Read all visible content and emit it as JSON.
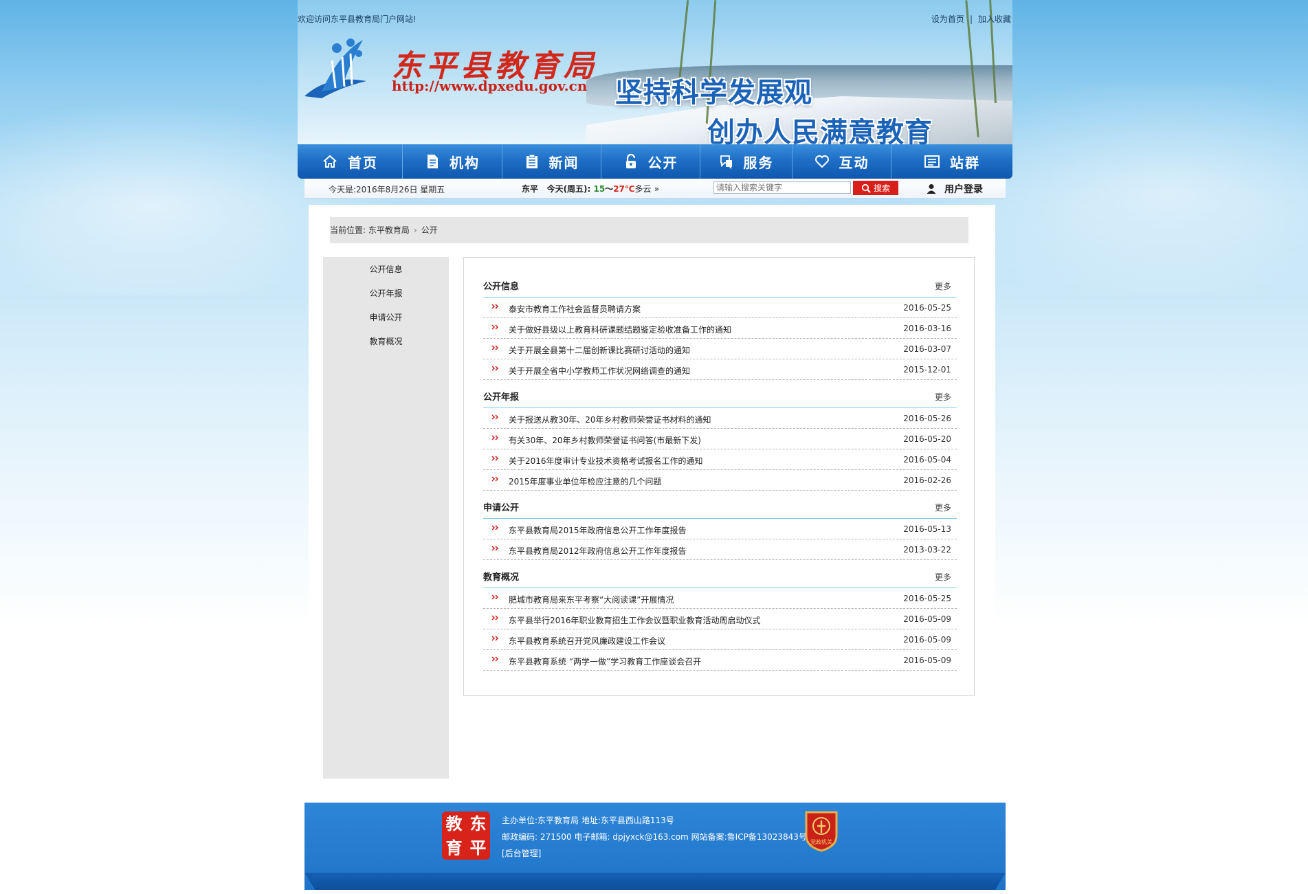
{
  "header": {
    "welcome": "欢迎访问东平县教育局门户网站!",
    "set_home": "设为首页",
    "separator": "|",
    "add_favorite": "加入收藏",
    "site_name": "东平县教育局",
    "site_url": "http://www.dpxedu.gov.cn",
    "slogan_line1": "坚持科学发展观",
    "slogan_line2": "创办人民满意教育"
  },
  "nav": {
    "items": [
      {
        "label": "首页",
        "icon": "home-icon"
      },
      {
        "label": "机构",
        "icon": "document-icon"
      },
      {
        "label": "新闻",
        "icon": "clipboard-icon"
      },
      {
        "label": "公开",
        "icon": "lock-icon"
      },
      {
        "label": "服务",
        "icon": "service-icon"
      },
      {
        "label": "互动",
        "icon": "heart-icon"
      },
      {
        "label": "站群",
        "icon": "list-icon"
      }
    ]
  },
  "infobar": {
    "today": "今天是:2016年8月26日  星期五",
    "weather_city": "东平",
    "weather_day": "今天(周五):",
    "temp_low": "15",
    "temp_sep": "～",
    "temp_high": "27℃",
    "weather_desc": "多云",
    "weather_more": "»",
    "search_placeholder": "请输入搜索关键字",
    "search_button": "搜索",
    "login": "用户登录"
  },
  "breadcrumb": {
    "label": "当前位置:",
    "home": "东平教育局",
    "current": "公开"
  },
  "sidebar": {
    "items": [
      "公开信息",
      "公开年报",
      "申请公开",
      "教育概况"
    ]
  },
  "sections": [
    {
      "title": "公开信息",
      "more": "更多",
      "rows": [
        {
          "title": "泰安市教育工作社会监督员聘请方案",
          "date": "2016-05-25"
        },
        {
          "title": "关于做好县级以上教育科研课题结题鉴定验收准备工作的通知",
          "date": "2016-03-16"
        },
        {
          "title": "关于开展全县第十二届创新课比赛研讨活动的通知",
          "date": "2016-03-07"
        },
        {
          "title": "关于开展全省中小学教师工作状况网络调查的通知",
          "date": "2015-12-01"
        }
      ]
    },
    {
      "title": "公开年报",
      "more": "更多",
      "rows": [
        {
          "title": "关于报送从教30年、20年乡村教师荣誉证书材料的通知",
          "date": "2016-05-26"
        },
        {
          "title": "有关30年、20年乡村教师荣誉证书问答(市最新下发)",
          "date": "2016-05-20"
        },
        {
          "title": "关于2016年度审计专业技术资格考试报名工作的通知",
          "date": "2016-05-04"
        },
        {
          "title": "2015年度事业单位年检应注意的几个问题",
          "date": "2016-02-26"
        }
      ]
    },
    {
      "title": "申请公开",
      "more": "更多",
      "rows": [
        {
          "title": "东平县教育局2015年政府信息公开工作年度报告",
          "date": "2016-05-13"
        },
        {
          "title": "东平县教育局2012年政府信息公开工作年度报告",
          "date": "2013-03-22"
        }
      ]
    },
    {
      "title": "教育概况",
      "more": "更多",
      "rows": [
        {
          "title": "肥城市教育局来东平考察“大阅读课”开展情况",
          "date": "2016-05-25"
        },
        {
          "title": "东平县举行2016年职业教育招生工作会议暨职业教育活动周启动仪式",
          "date": "2016-05-09"
        },
        {
          "title": "东平县教育系统召开党风廉政建设工作会议",
          "date": "2016-05-09"
        },
        {
          "title": "东平县教育系统 “两学一做”学习教育工作座谈会召开",
          "date": "2016-05-09"
        }
      ]
    }
  ],
  "footer": {
    "logo_chars": [
      "教",
      "东",
      "育",
      "平"
    ],
    "line1": "主办单位:东平教育局 地址:东平县西山路113号",
    "line2": "邮政编码: 271500 电子邮箱: dpjyxck@163.com 网站备案:鲁ICP备13023843号-2",
    "admin": "[后台管理]",
    "badge_text": "党政机关"
  },
  "colors": {
    "nav_blue": "#1f6fc6",
    "accent_red": "#d91f1a",
    "section_line": "#7ccae9",
    "panel_gray": "#e6e6e6"
  }
}
